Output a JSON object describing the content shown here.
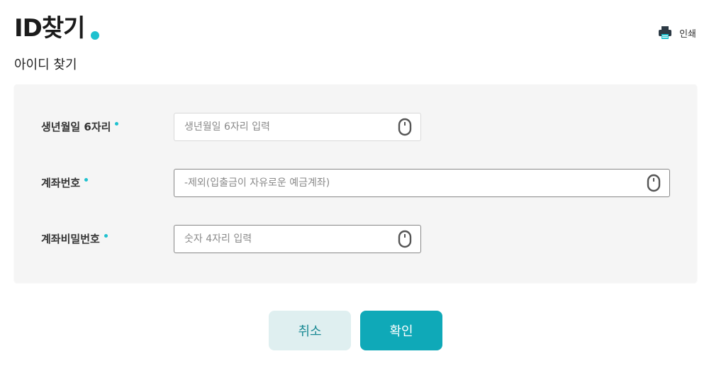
{
  "header": {
    "title": "ID찾기",
    "print_label": "인쇄",
    "print_icon": "printer-icon"
  },
  "subtitle": "아이디 찾기",
  "form": {
    "fields": [
      {
        "label": "생년월일 6자리",
        "placeholder": "생년월일 6자리 입력",
        "value": "",
        "icon": "mouse-icon"
      },
      {
        "label": "계좌번호",
        "placeholder": "-제외(입출금이 자유로운 예금계좌)",
        "value": "",
        "icon": "mouse-icon"
      },
      {
        "label": "계좌비밀번호",
        "placeholder": "숫자 4자리 입력",
        "value": "",
        "icon": "mouse-icon"
      }
    ]
  },
  "buttons": {
    "cancel": "취소",
    "confirm": "확인"
  },
  "colors": {
    "accent": "#1ec1cf",
    "confirm_bg": "#0fa9b8",
    "cancel_bg": "#dfeff0",
    "panel_bg": "#f5f5f5"
  }
}
